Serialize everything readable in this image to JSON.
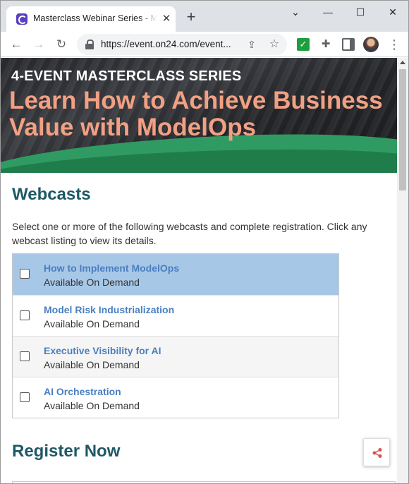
{
  "browser": {
    "tab_title": "Masterclass Webinar Series - ModelOps",
    "tab_close_glyph": "✕",
    "new_tab_glyph": "+",
    "url": "https://event.on24.com/event...",
    "window_controls": {
      "caret": "⌄",
      "minimize": "—",
      "maximize": "☐",
      "close": "✕"
    },
    "icons": [
      "back-icon",
      "forward-icon",
      "reload-icon",
      "lock-icon",
      "share-icon",
      "star-icon",
      "extension-check-icon",
      "puzzle-icon",
      "side-panel-icon",
      "avatar",
      "menu-icon"
    ]
  },
  "banner": {
    "eyebrow": "4-EVENT MASTERCLASS SERIES",
    "title": "Learn How to Achieve Business Value with ModelOps",
    "colors": {
      "title": "#f2a083",
      "wave": "#2f9b62"
    }
  },
  "webcasts": {
    "heading": "Webcasts",
    "intro": "Select one or more of the following webcasts and complete registration. Click any webcast listing to view its details.",
    "items": [
      {
        "title": "How to Implement ModelOps",
        "status": "Available On Demand",
        "checked": false,
        "highlighted": true
      },
      {
        "title": "Model Risk Industrialization",
        "status": "Available On Demand",
        "checked": false,
        "highlighted": false
      },
      {
        "title": "Executive Visibility for AI",
        "status": "Available On Demand",
        "checked": false,
        "highlighted": false
      },
      {
        "title": "AI Orchestration",
        "status": "Available On Demand",
        "checked": false,
        "highlighted": false
      }
    ]
  },
  "register": {
    "heading": "Register Now"
  },
  "colors": {
    "heading": "#1f5866",
    "link": "#4a7fc0",
    "selected_row": "#a7c7e7",
    "share_icon": "#d9534f"
  }
}
